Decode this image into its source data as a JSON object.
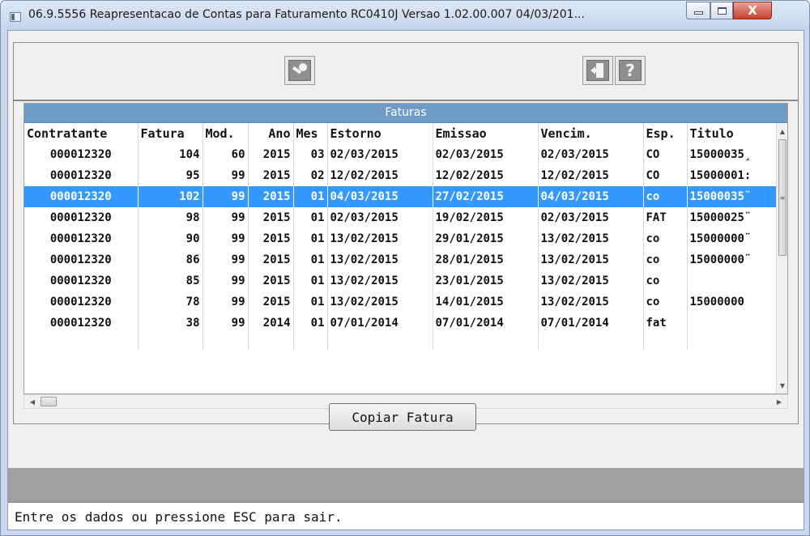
{
  "window": {
    "title": "06.9.5556 Reapresentacao de Contas para Faturamento RC0410J Versao 1.02.00.007 04/03/201...",
    "close_glyph": "X"
  },
  "toolbar": {
    "key_icon": "key-icon",
    "exit_icon": "exit-door-icon",
    "help_icon": "help-icon",
    "help_glyph": "?"
  },
  "grid": {
    "caption": "Faturas",
    "columns": [
      "Contratante",
      "Fatura",
      "Mod.",
      "Ano",
      "Mes",
      "Estorno",
      "Emissao",
      "Vencim.",
      "Esp.",
      "Titulo"
    ],
    "rows": [
      [
        "000012320",
        "104",
        "60",
        "2015",
        "03",
        "02/03/2015",
        "02/03/2015",
        "02/03/2015",
        "CO",
        "15000035¸"
      ],
      [
        "000012320",
        "95",
        "99",
        "2015",
        "02",
        "12/02/2015",
        "12/02/2015",
        "12/02/2015",
        "CO",
        "15000001:"
      ],
      [
        "000012320",
        "102",
        "99",
        "2015",
        "01",
        "04/03/2015",
        "27/02/2015",
        "04/03/2015",
        "co",
        "15000035̈"
      ],
      [
        "000012320",
        "98",
        "99",
        "2015",
        "01",
        "02/03/2015",
        "19/02/2015",
        "02/03/2015",
        "FAT",
        "15000025̈"
      ],
      [
        "000012320",
        "90",
        "99",
        "2015",
        "01",
        "13/02/2015",
        "29/01/2015",
        "13/02/2015",
        "co",
        "15000000̈"
      ],
      [
        "000012320",
        "86",
        "99",
        "2015",
        "01",
        "13/02/2015",
        "28/01/2015",
        "13/02/2015",
        "co",
        "15000000̈"
      ],
      [
        "000012320",
        "85",
        "99",
        "2015",
        "01",
        "13/02/2015",
        "23/01/2015",
        "13/02/2015",
        "co",
        ""
      ],
      [
        "000012320",
        "78",
        "99",
        "2015",
        "01",
        "13/02/2015",
        "14/01/2015",
        "13/02/2015",
        "co",
        "15000000"
      ],
      [
        "000012320",
        "38",
        "99",
        "2014",
        "01",
        "07/01/2014",
        "07/01/2014",
        "07/01/2014",
        "fat",
        ""
      ]
    ],
    "selected_row_index": 2,
    "selection_color": "#3399ff",
    "caption_color": "#6f9bc6"
  },
  "actions": {
    "copy_label": "Copiar Fatura"
  },
  "status": {
    "message": "Entre os dados ou pressione ESC para sair."
  }
}
